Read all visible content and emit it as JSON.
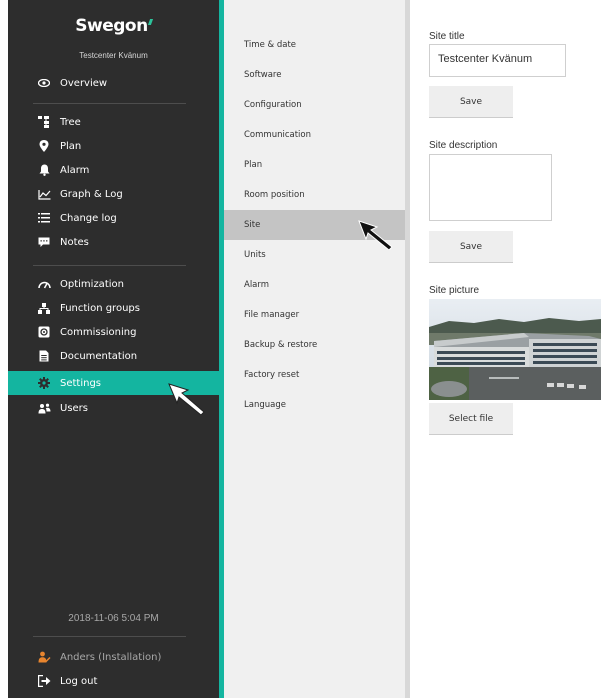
{
  "brand": {
    "logo_text": "Swegon",
    "site_name": "Testcenter Kvänum"
  },
  "sidebar": {
    "items": [
      {
        "label": "Overview",
        "icon": "eye-icon"
      },
      {
        "label": "Tree",
        "icon": "tree-icon"
      },
      {
        "label": "Plan",
        "icon": "map-pin-icon"
      },
      {
        "label": "Alarm",
        "icon": "bell-icon"
      },
      {
        "label": "Graph & Log",
        "icon": "line-chart-icon"
      },
      {
        "label": "Change log",
        "icon": "list-icon"
      },
      {
        "label": "Notes",
        "icon": "comment-icon"
      },
      {
        "label": "Optimization",
        "icon": "gauge-icon"
      },
      {
        "label": "Function groups",
        "icon": "hierarchy-icon"
      },
      {
        "label": "Commissioning",
        "icon": "commissioning-icon"
      },
      {
        "label": "Documentation",
        "icon": "document-icon"
      },
      {
        "label": "Settings",
        "icon": "gear-icon"
      },
      {
        "label": "Users",
        "icon": "users-icon"
      }
    ],
    "active": "Settings",
    "datetime": "2018-11-06 5:04 PM",
    "user": "Anders (Installation)",
    "logout": "Log out",
    "accent": "#14b5a0"
  },
  "submenu": {
    "items": [
      "Time & date",
      "Software",
      "Configuration",
      "Communication",
      "Plan",
      "Room position",
      "Site",
      "Units",
      "Alarm",
      "File manager",
      "Backup & restore",
      "Factory reset",
      "Language"
    ],
    "active": "Site"
  },
  "main": {
    "site_title_label": "Site title",
    "site_title_value": "Testcenter Kvänum",
    "save_label_1": "Save",
    "site_description_label": "Site description",
    "site_description_value": "",
    "save_label_2": "Save",
    "site_picture_label": "Site picture",
    "select_file_label": "Select file"
  }
}
